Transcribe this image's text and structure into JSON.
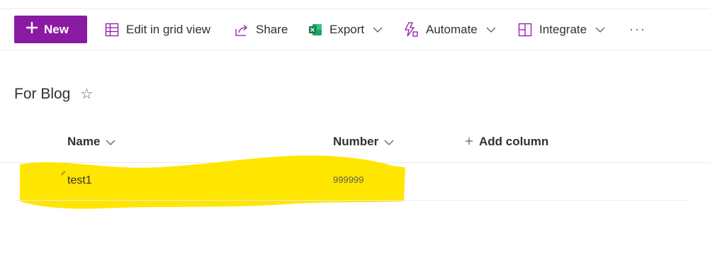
{
  "commandbar": {
    "new_label": "New",
    "edit_grid_label": "Edit in grid view",
    "share_label": "Share",
    "export_label": "Export",
    "automate_label": "Automate",
    "integrate_label": "Integrate",
    "more_label": "···"
  },
  "list": {
    "title": "For Blog",
    "columns": [
      {
        "label": "Name"
      },
      {
        "label": "Number"
      },
      {
        "label": "Add column"
      }
    ],
    "rows": [
      {
        "name": "test1",
        "number": "999999"
      }
    ]
  },
  "colors": {
    "accent": "#8b1aa3",
    "highlight": "#ffe600",
    "excel_green": "#107c41"
  },
  "icons": [
    "plus-icon",
    "grid-icon",
    "share-icon",
    "excel-icon",
    "automate-icon",
    "integrate-icon",
    "chevron-down-icon",
    "star-icon",
    "more-icon"
  ]
}
